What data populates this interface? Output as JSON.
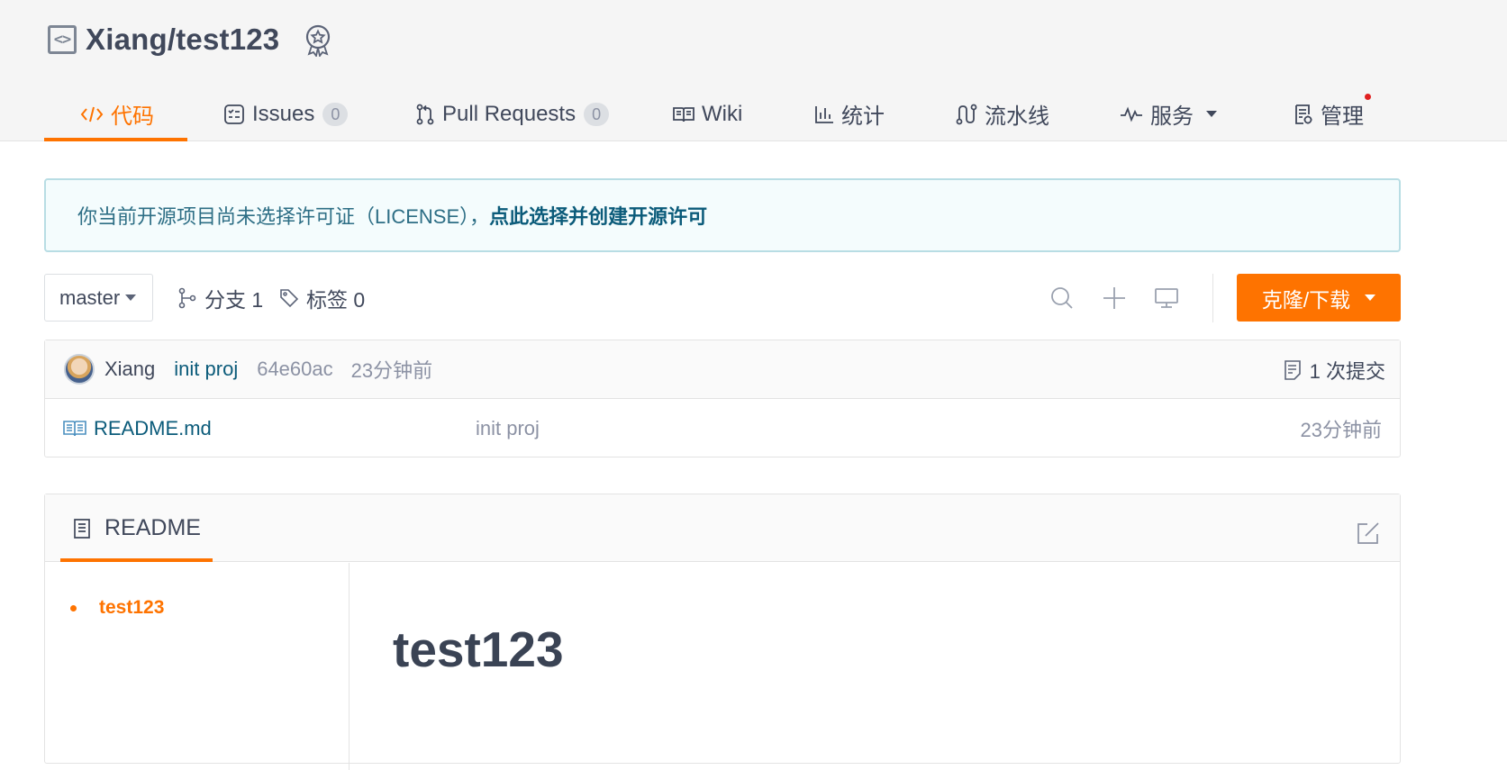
{
  "repo": {
    "title": "Xiang/test123",
    "icon": "code-icon",
    "badge_icon": "award-badge-icon"
  },
  "tabs": [
    {
      "label": "代码",
      "icon": "code-icon",
      "active": true
    },
    {
      "label": "Issues",
      "icon": "issues-icon",
      "count": "0"
    },
    {
      "label": "Pull Requests",
      "icon": "pull-request-icon",
      "count": "0"
    },
    {
      "label": "Wiki",
      "icon": "book-icon"
    },
    {
      "label": "统计",
      "icon": "bar-chart-icon"
    },
    {
      "label": "流水线",
      "icon": "pipeline-icon"
    },
    {
      "label": "服务",
      "icon": "pulse-icon",
      "dropdown": true
    },
    {
      "label": "管理",
      "icon": "manage-icon",
      "notification_dot": true
    }
  ],
  "notice": {
    "text": "你当前开源项目尚未选择许可证（LICENSE），",
    "link": "点此选择并创建开源许可"
  },
  "toolbar": {
    "branch": "master",
    "branches_label": "分支 1",
    "tags_label": "标签 0",
    "clone_label": "克隆/下载"
  },
  "last_commit": {
    "author": "Xiang",
    "message": "init proj",
    "hash": "64e60ac",
    "time": "23分钟前",
    "commit_count": "1 次提交"
  },
  "files": [
    {
      "name": "README.md",
      "message": "init proj",
      "time": "23分钟前"
    }
  ],
  "readme": {
    "tab_label": "README",
    "toc": [
      "test123"
    ],
    "heading": "test123"
  },
  "colors": {
    "accent": "#fe7300",
    "link": "#0b5b7a",
    "text": "#40485b",
    "muted": "#8c92a4",
    "notice_bg": "#f4fcfd",
    "notice_border": "#b8dde4"
  }
}
